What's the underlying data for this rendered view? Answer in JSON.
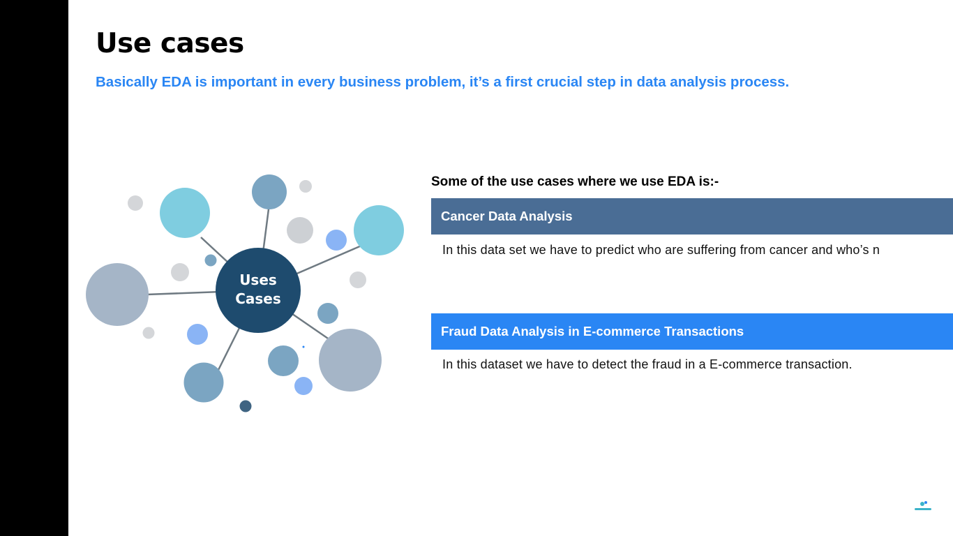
{
  "slide": {
    "title": "Use cases",
    "subtitle": "Basically EDA is important in every business problem, it’s a first crucial step in data analysis process.",
    "diagram": {
      "hub_label_line1": "Uses",
      "hub_label_line2": "Cases"
    },
    "intro": "Some of the use cases where we use EDA is:-",
    "use_cases": [
      {
        "title": "Cancer Data Analysis",
        "description": "In this data set we have to predict who are suffering from cancer and who’s n",
        "color": "#4a6d95"
      },
      {
        "title": "Fraud Data Analysis in E-commerce Transactions",
        "description": "In this dataset we have to detect the fraud in a E-commerce transaction.",
        "color": "#2a86f4"
      }
    ]
  },
  "colors": {
    "accent_blue": "#2a86f4",
    "hub_navy": "#1e4b6e",
    "side_bar": "#000000"
  }
}
